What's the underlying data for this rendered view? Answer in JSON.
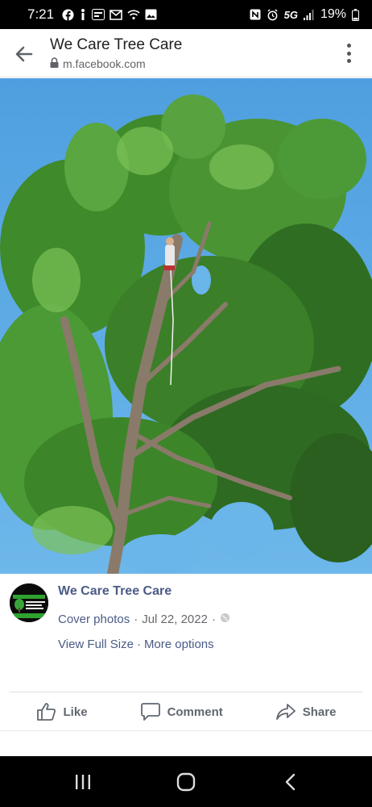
{
  "status_bar": {
    "time": "7:21",
    "network": "5G",
    "battery": "19%",
    "icons": [
      "facebook-icon",
      "info-icon",
      "caller-id-icon",
      "gmail-icon",
      "wifi-calling-icon",
      "gallery-icon",
      "nfc-icon",
      "alarm-icon",
      "signal-icon",
      "battery-icon"
    ]
  },
  "browser": {
    "page_title": "We Care Tree Care",
    "url": "m.facebook.com"
  },
  "post": {
    "page_name": "We Care Tree Care",
    "album": "Cover photos",
    "separator": "·",
    "date": "Jul 22, 2022",
    "view_full_size": "View Full Size",
    "more_options": "More options",
    "avatar_logo_text": "WE CARE TREE CARE"
  },
  "actions": {
    "like": "Like",
    "comment": "Comment",
    "share": "Share"
  },
  "colors": {
    "link": "#4b5b86",
    "sky": "#5aa9e6",
    "foliage": "#3f8a2a"
  }
}
